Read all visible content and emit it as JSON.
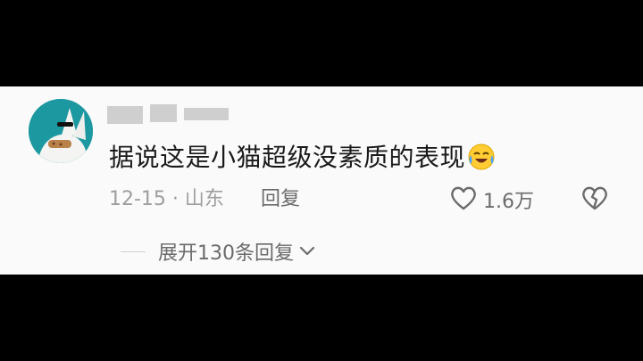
{
  "comment": {
    "text": "据说这是小猫超级没素质的表现",
    "emoji": "face-with-tears-of-joy-icon",
    "date_location": "12-15 · 山东",
    "reply_label": "回复",
    "like_count": "1.6万"
  },
  "replies": {
    "expand_label": "展开130条回复"
  },
  "colors": {
    "background": "#000000",
    "card": "#fafafa",
    "text": "#1a1a1a",
    "meta": "#9e9e9e"
  }
}
